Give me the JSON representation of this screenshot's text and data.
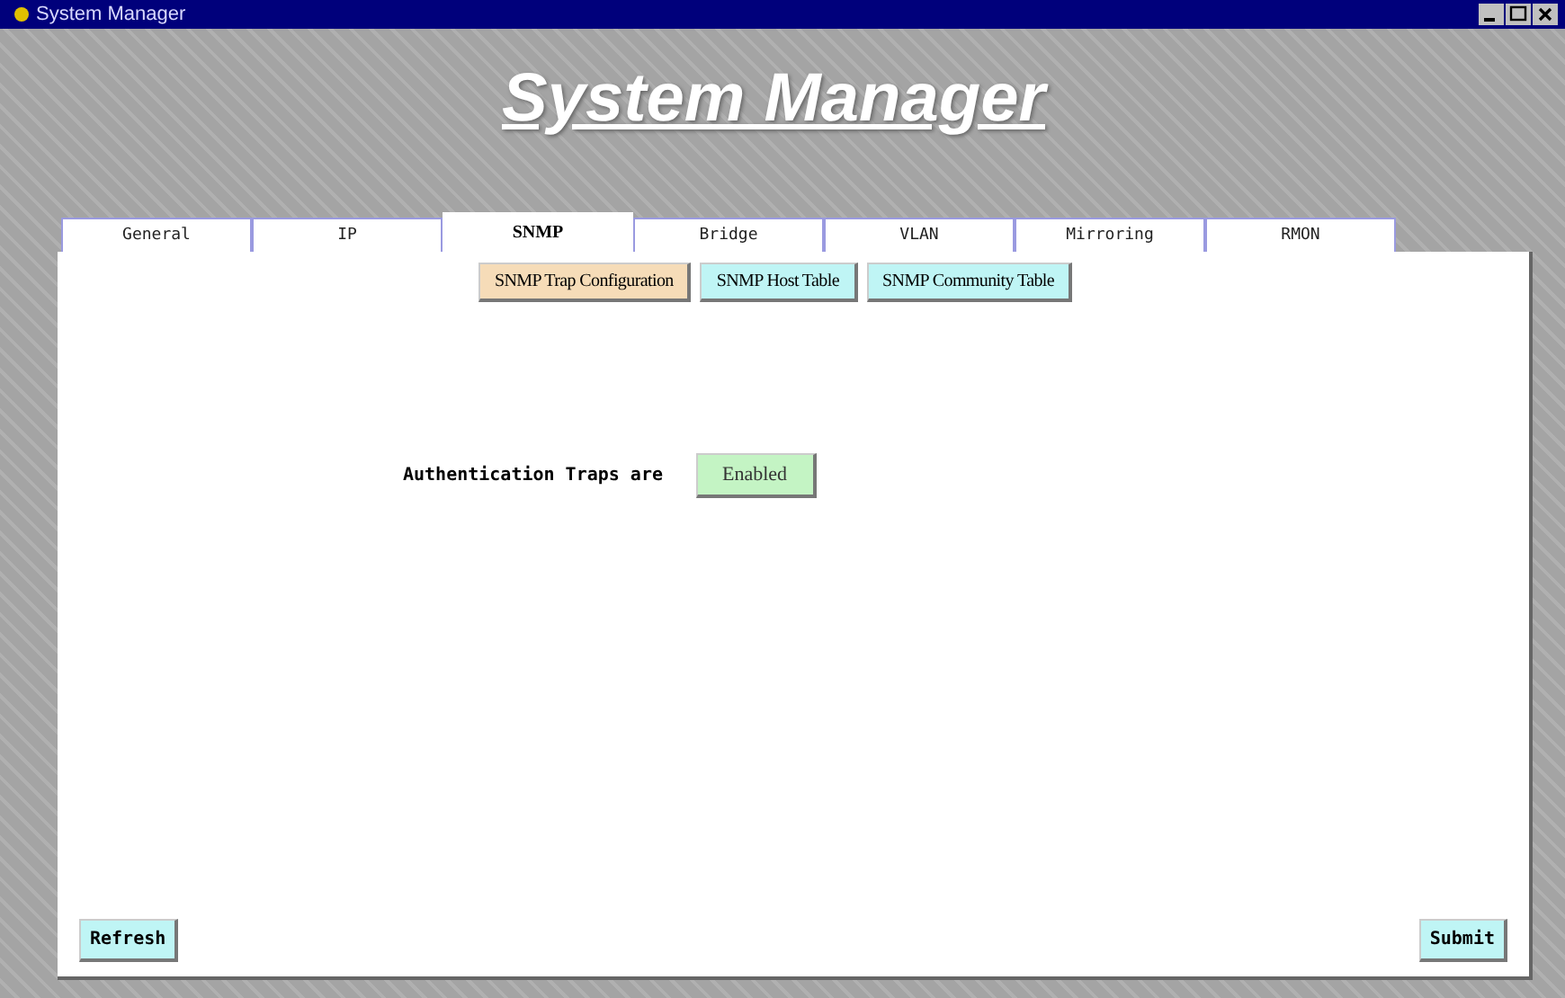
{
  "window": {
    "title": "System Manager"
  },
  "header": {
    "title": "System Manager"
  },
  "tabs": [
    {
      "label": "General",
      "selected": false
    },
    {
      "label": "IP",
      "selected": false
    },
    {
      "label": "SNMP",
      "selected": true
    },
    {
      "label": "Bridge",
      "selected": false
    },
    {
      "label": "VLAN",
      "selected": false
    },
    {
      "label": "Mirroring",
      "selected": false
    },
    {
      "label": "RMON",
      "selected": false
    }
  ],
  "subtabs": [
    {
      "label": "SNMP Trap Configuration",
      "selected": true
    },
    {
      "label": "SNMP Host Table",
      "selected": false
    },
    {
      "label": "SNMP Community Table",
      "selected": false
    }
  ],
  "auth_traps": {
    "label": "Authentication Traps are",
    "value": "Enabled"
  },
  "buttons": {
    "refresh": "Refresh",
    "submit": "Submit"
  }
}
